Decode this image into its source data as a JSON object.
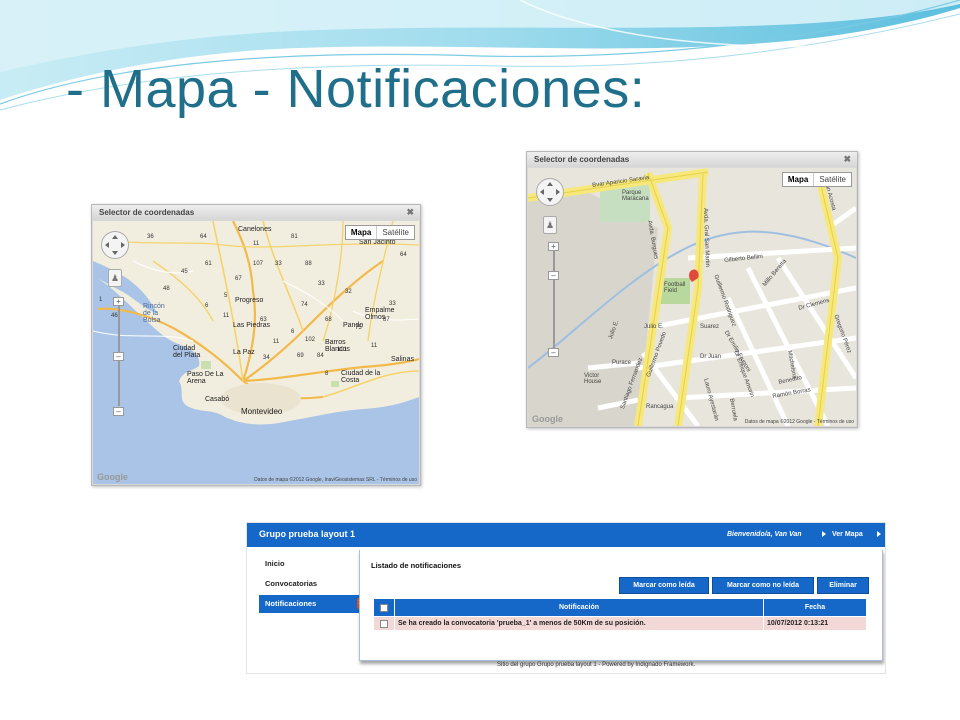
{
  "slide": {
    "title": "- Mapa - Notificaciones:"
  },
  "map_left": {
    "window_title": "Selector de coordenadas",
    "maptype_on": "Mapa",
    "maptype_off": "Satélite",
    "footer": "Datos de mapa ©2012 Google, Inav/Geosistemas SRL - Términos de uso",
    "logo": "Google",
    "places": [
      "Canelones",
      "San Jacinto",
      "Progreso",
      "Las Piedras",
      "Pando",
      "Empalme Olmos",
      "Ciudad del Plata",
      "La Paz",
      "Barros Blancos",
      "Paso De La Arena",
      "Ciudad de la Costa",
      "Casabó",
      "Montevideo",
      "Salinas",
      "Rincón de la Bolsa"
    ],
    "routes": [
      "36",
      "64",
      "11",
      "81",
      "107",
      "33",
      "88",
      "64",
      "61",
      "45",
      "67",
      "48",
      "5",
      "33",
      "32",
      "6",
      "74",
      "33",
      "46",
      "68",
      "1",
      "63",
      "6",
      "75",
      "11",
      "11",
      "69",
      "102",
      "84",
      "101",
      "34",
      "87",
      "8",
      "11"
    ]
  },
  "map_right": {
    "window_title": "Selector de coordenadas",
    "maptype_on": "Mapa",
    "maptype_off": "Satélite",
    "footer": "Datos de mapa ©2012 Google - Términos de uso",
    "logo": "Google",
    "streets": [
      "Bvar Aparicio Saravia",
      "Parque Maracana",
      "Avda. Burgues",
      "Avda. Gral San Martin",
      "Juan Acosta",
      "Gilberto Bellini",
      "Guillermo Rodriguez",
      "Millo Beretta",
      "Football Field",
      "Julio E.",
      "Dr Emilio Frugoni",
      "Dr Clemens",
      "Gregorio Pérez",
      "Purace",
      "Suarez",
      "Dr Juan",
      "Dr Enrique Amorin",
      "Lauro Ayestarán",
      "Victor House",
      "Ramón Borras",
      "Guillermo Povedo",
      "Santiago Fernandez",
      "Mitchelsna",
      "Rancagua",
      "Berruela",
      "Benedito",
      "Julio E."
    ]
  },
  "app": {
    "title": "Grupo prueba layout 1",
    "welcome": "Bienvenido/a, Van Van",
    "ver_mapa": "Ver Mapa",
    "menu": [
      "Inicio",
      "Convocatorias",
      "Notificaciones"
    ],
    "badge": "1",
    "panel_title": "Listado de notificaciones",
    "buttons": {
      "mark_read": "Marcar como leída",
      "mark_unread": "Marcar como no leída",
      "delete": "Eliminar"
    },
    "table": {
      "headers": [
        "Notificación",
        "Fecha"
      ],
      "rows": [
        {
          "text": "Se ha creado la convocatoria 'prueba_1' a menos de 50Km de su posición.",
          "date": "10/07/2012 0:13:21"
        }
      ]
    },
    "footer": "Sitio del grupo Grupo prueba layout 1 - Powered by Indignado Framework."
  }
}
